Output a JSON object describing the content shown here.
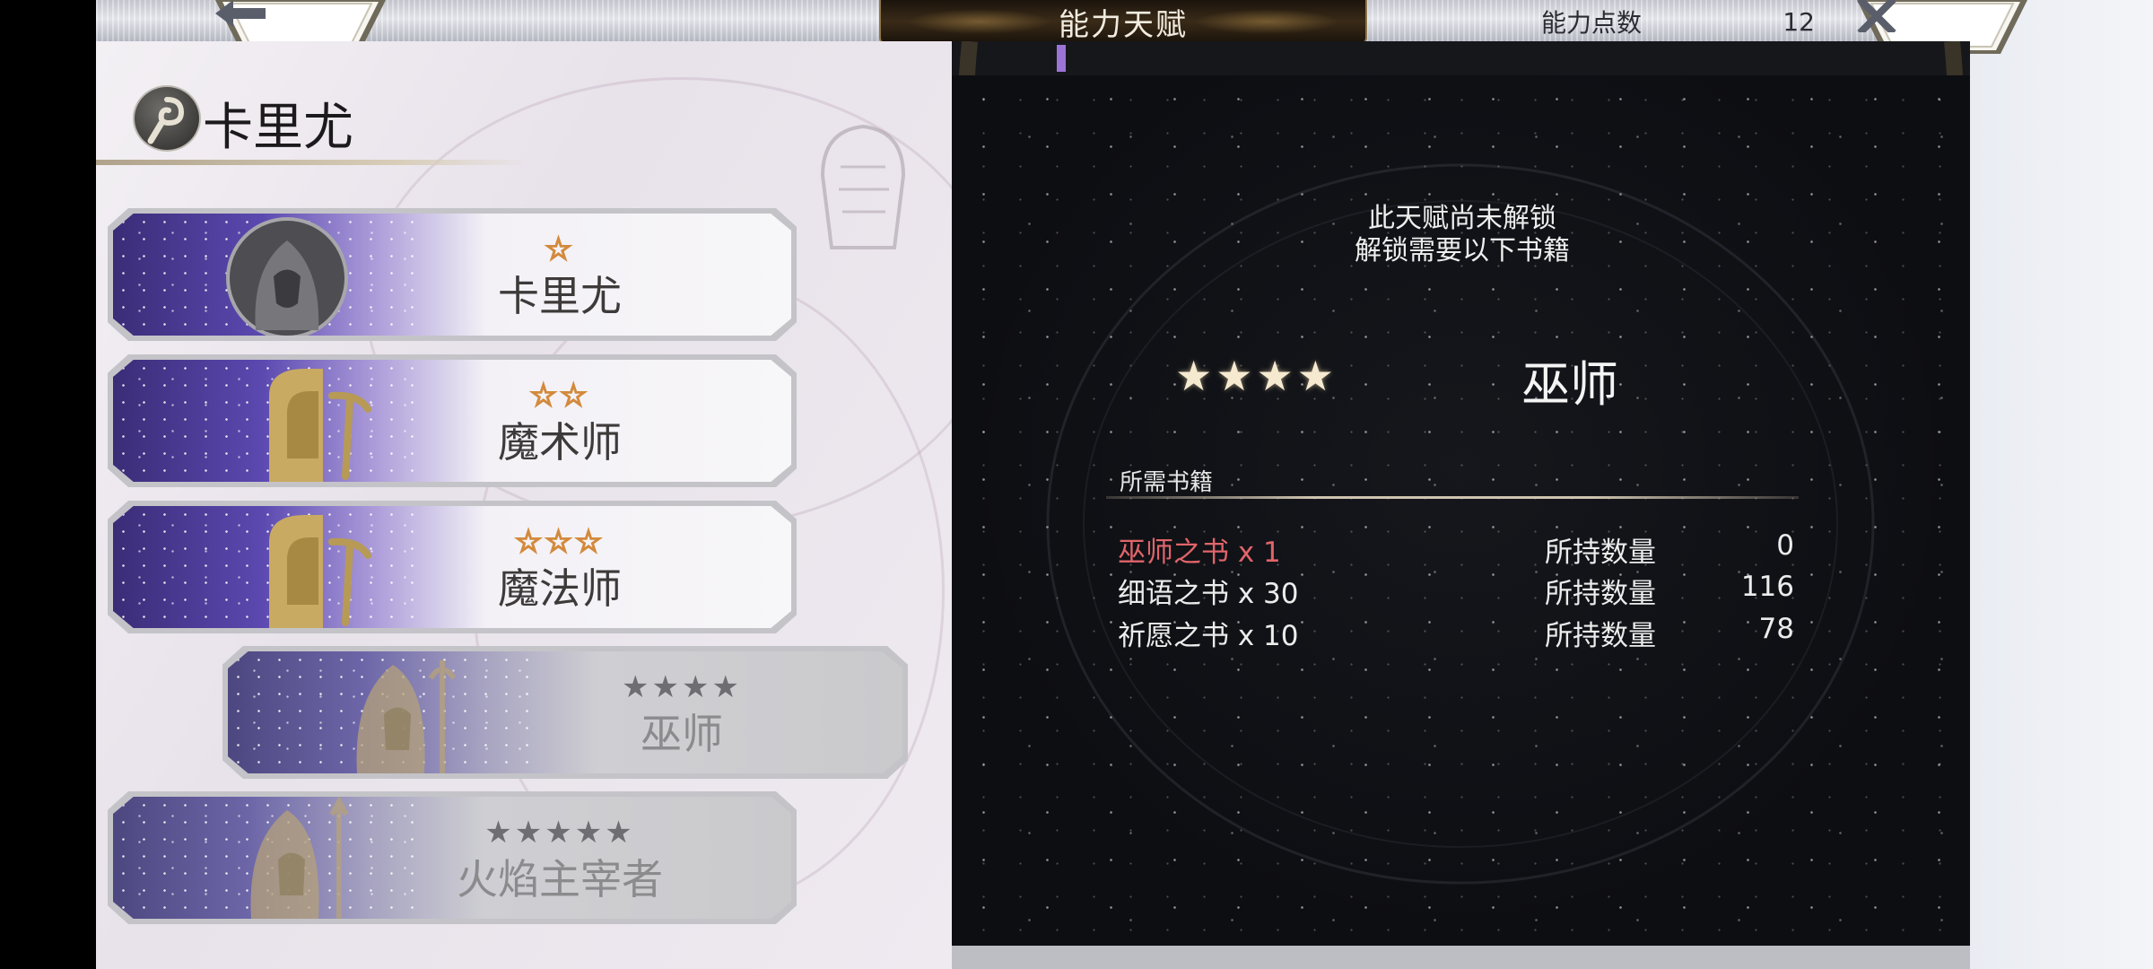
{
  "header": {
    "title": "能力天赋",
    "points_label": "能力点数",
    "points_value": "12",
    "back_icon": "arrow-left-icon",
    "close_icon": "close-x-icon"
  },
  "character": {
    "name": "卡里尤",
    "icon": "staff-emblem-icon"
  },
  "talents": [
    {
      "stars": "☆",
      "name": "卡里尤",
      "locked": false
    },
    {
      "stars": "☆☆",
      "name": "魔术师",
      "locked": false
    },
    {
      "stars": "☆☆☆",
      "name": "魔法师",
      "locked": false
    },
    {
      "stars": "★★★★",
      "name": "巫师",
      "locked": true,
      "selected": true
    },
    {
      "stars": "★★★★★",
      "name": "火焰主宰者",
      "locked": true
    }
  ],
  "detail": {
    "message_line1": "此天赋尚未解锁",
    "message_line2": "解锁需要以下书籍",
    "stars": "★★★★",
    "class_name": "巫师",
    "required_label": "所需书籍",
    "books": [
      {
        "name": "巫师之书 x 1",
        "held_label": "所持数量",
        "held": "0",
        "missing": true
      },
      {
        "name": "细语之书 x 30",
        "held_label": "所持数量",
        "held": "116",
        "missing": false
      },
      {
        "name": "祈愿之书 x 10",
        "held_label": "所持数量",
        "held": "78",
        "missing": false
      }
    ]
  },
  "colors": {
    "missing_text": "#e0656a",
    "star_outline": "#d38a3c",
    "accent": "#9c73d6"
  }
}
